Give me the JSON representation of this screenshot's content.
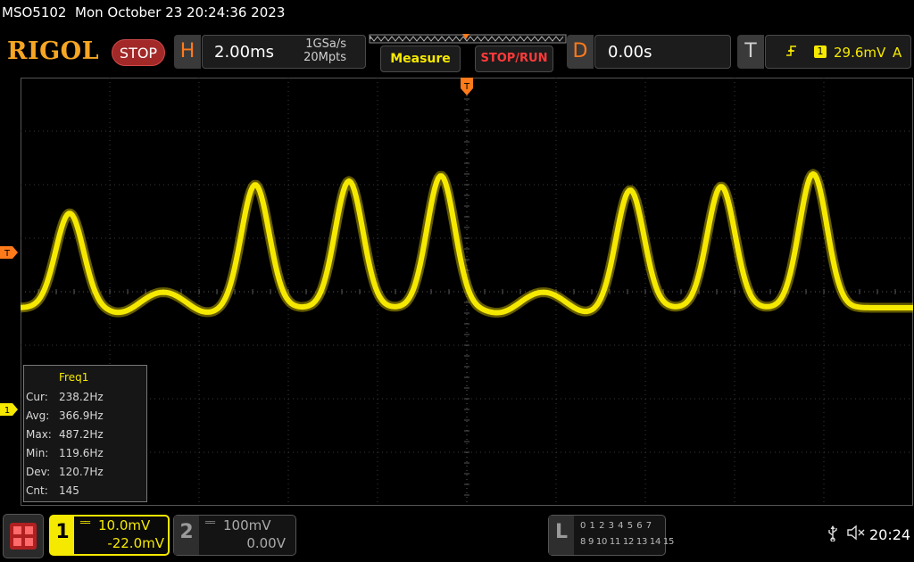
{
  "title_bar": {
    "model": "MSO5102",
    "datetime": "Mon October 23 20:24:36 2023"
  },
  "brand": {
    "logo": "RIGOL"
  },
  "run_state": "STOP",
  "horizontal": {
    "letter": "H",
    "timebase": "2.00ms",
    "sample_rate": "1GSa/s",
    "memory_depth": "20Mpts"
  },
  "buttons": {
    "measure": "Measure",
    "stop_run": "STOP/RUN"
  },
  "delay": {
    "letter": "D",
    "value": "0.00s"
  },
  "trigger": {
    "letter": "T",
    "source": "1",
    "level": "29.6mV",
    "mode": "A",
    "slope_icon": "rising-edge-icon",
    "marker": "T"
  },
  "measurement": {
    "title": "Freq1",
    "rows": [
      {
        "label": "Cur:",
        "value": "238.2Hz"
      },
      {
        "label": "Avg:",
        "value": "366.9Hz"
      },
      {
        "label": "Max:",
        "value": "487.2Hz"
      },
      {
        "label": "Min:",
        "value": "119.6Hz"
      },
      {
        "label": "Dev:",
        "value": "120.7Hz"
      },
      {
        "label": "Cnt:",
        "value": "145"
      }
    ]
  },
  "channels": {
    "ch1": {
      "number": "1",
      "scale": "10.0mV",
      "offset": "-22.0mV",
      "color": "#f6e900"
    },
    "ch2": {
      "number": "2",
      "scale": "100mV",
      "offset": "0.00V",
      "color": "#9a9a9a"
    }
  },
  "logic": {
    "letter": "L",
    "row1": "0 1 2 3  4 5 6 7",
    "row2": "8 9 10 11 12 13 14 15"
  },
  "status": {
    "clock": "20:24",
    "usb_icon": "usb-icon",
    "sound_icon": "sound-muted-icon"
  },
  "colors": {
    "trace": "#f6e900",
    "accent": "#ff7a1a",
    "grid": "#3a3a3a"
  }
}
